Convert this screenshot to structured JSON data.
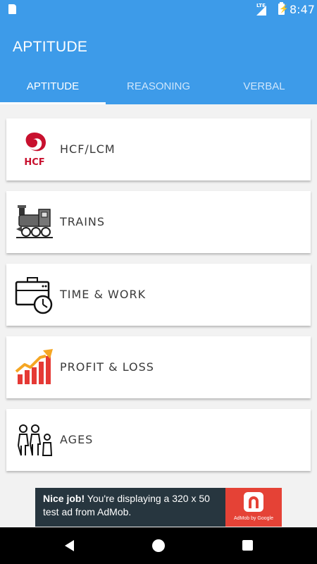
{
  "status_bar": {
    "network": "LTE",
    "time": "8:47"
  },
  "app_bar": {
    "title": "APTITUDE"
  },
  "tabs": [
    {
      "label": "APTITUDE",
      "active": true
    },
    {
      "label": "REASONING",
      "active": false
    },
    {
      "label": "VERBAL",
      "active": false
    }
  ],
  "topics": [
    {
      "label": "HCF/LCM",
      "icon": "hcf-icon",
      "icon_text": "HCF"
    },
    {
      "label": "TRAINS",
      "icon": "train-icon"
    },
    {
      "label": "TIME & WORK",
      "icon": "briefcase-clock-icon"
    },
    {
      "label": "PROFIT & LOSS",
      "icon": "profit-chart-icon"
    },
    {
      "label": "AGES",
      "icon": "family-icon"
    }
  ],
  "ad": {
    "bold": "Nice job!",
    "text": " You're displaying a 320 x 50 test ad from AdMob.",
    "brand": "AdMob by Google"
  },
  "colors": {
    "primary": "#3d9be9",
    "ad_background": "#27363f",
    "ad_accent": "#e54236"
  }
}
